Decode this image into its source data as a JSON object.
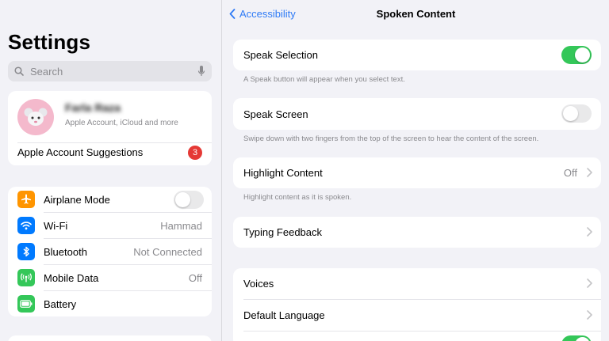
{
  "sidebar": {
    "title": "Settings",
    "search": {
      "placeholder": "Search"
    },
    "account": {
      "name": "Farla Raza",
      "subtitle": "Apple Account, iCloud and more",
      "suggestions_label": "Apple Account Suggestions",
      "badge_count": "3"
    },
    "network_items": [
      {
        "label": "Airplane Mode",
        "value": "",
        "icon": "airplane-icon",
        "color": "#ff9500",
        "toggle": false
      },
      {
        "label": "Wi-Fi",
        "value": "Hammad",
        "icon": "wifi-icon",
        "color": "#007aff"
      },
      {
        "label": "Bluetooth",
        "value": "Not Connected",
        "icon": "bluetooth-icon",
        "color": "#007aff"
      },
      {
        "label": "Mobile Data",
        "value": "Off",
        "icon": "antenna-icon",
        "color": "#34c759"
      },
      {
        "label": "Battery",
        "value": "",
        "icon": "battery-icon",
        "color": "#34c759"
      }
    ]
  },
  "detail": {
    "back_label": "Accessibility",
    "title": "Spoken Content",
    "speak_selection": {
      "label": "Speak Selection",
      "on": true,
      "footnote": "A Speak button will appear when you select text."
    },
    "speak_screen": {
      "label": "Speak Screen",
      "on": false,
      "footnote": "Swipe down with two fingers from the top of the screen to hear the content of the screen."
    },
    "highlight_content": {
      "label": "Highlight Content",
      "value": "Off",
      "footnote": "Highlight content as it is spoken."
    },
    "typing_feedback": {
      "label": "Typing Feedback"
    },
    "voices": {
      "label": "Voices"
    },
    "default_language": {
      "label": "Default Language"
    }
  },
  "colors": {
    "accent": "#2f7bf6",
    "toggle_on": "#34c759",
    "toggle_off": "#e9e9ea",
    "badge": "#e53935",
    "background": "#f2f2f7"
  }
}
